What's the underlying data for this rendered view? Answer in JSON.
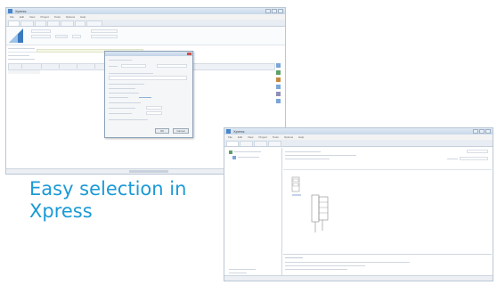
{
  "caption": {
    "line1": "Easy selection in",
    "line2": "Xpress"
  },
  "colors": {
    "caption": "#1a9ad6",
    "accent": "#4a86c8",
    "window_border": "#b9c6d6"
  },
  "screenshot_left": {
    "title": "Xpress",
    "menu": [
      "File",
      "Edit",
      "View",
      "Project",
      "Tools",
      "Options",
      "Help"
    ],
    "dialog": {
      "ok_label": "OK",
      "cancel_label": "Cancel"
    }
  },
  "screenshot_right": {
    "title": "Xpress",
    "menu": [
      "File",
      "Edit",
      "View",
      "Project",
      "Tools",
      "Options",
      "Help"
    ]
  },
  "icons": [
    "app-icon",
    "minimize-icon",
    "maximize-icon",
    "close-icon",
    "logo-icon",
    "toolbar-icon",
    "tree-node-icon",
    "component-drawing-icon"
  ]
}
